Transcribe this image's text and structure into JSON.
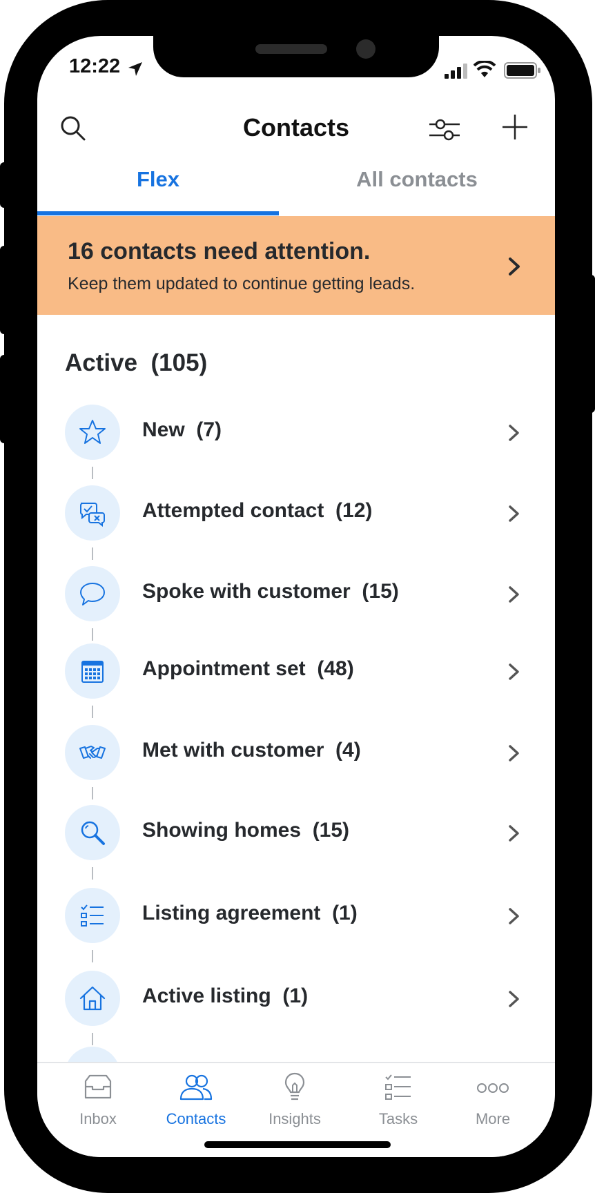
{
  "status_bar": {
    "time": "12:22"
  },
  "nav": {
    "title": "Contacts"
  },
  "tabs": [
    {
      "label": "Flex",
      "active": true
    },
    {
      "label": "All contacts",
      "active": false
    }
  ],
  "banner": {
    "title": "16 contacts need attention.",
    "subtitle": "Keep them updated to continue getting leads."
  },
  "section": {
    "label": "Active",
    "count": "(105)"
  },
  "stages": [
    {
      "label": "New",
      "count": "(7)",
      "icon": "star-icon"
    },
    {
      "label": "Attempted contact",
      "count": "(12)",
      "icon": "chat-bubbles-icon"
    },
    {
      "label": "Spoke with customer",
      "count": "(15)",
      "icon": "speech-bubble-icon"
    },
    {
      "label": "Appointment set",
      "count": "(48)",
      "icon": "calendar-icon"
    },
    {
      "label": "Met with customer",
      "count": "(4)",
      "icon": "handshake-icon"
    },
    {
      "label": "Showing homes",
      "count": "(15)",
      "icon": "magnifier-icon"
    },
    {
      "label": "Listing agreement",
      "count": "(1)",
      "icon": "checklist-icon"
    },
    {
      "label": "Active listing",
      "count": "(1)",
      "icon": "house-icon"
    }
  ],
  "tabbar": [
    {
      "label": "Inbox",
      "icon": "inbox-icon",
      "active": false
    },
    {
      "label": "Contacts",
      "icon": "contacts-icon",
      "active": true
    },
    {
      "label": "Insights",
      "icon": "lightbulb-icon",
      "active": false
    },
    {
      "label": "Tasks",
      "icon": "tasks-icon",
      "active": false
    },
    {
      "label": "More",
      "icon": "more-icon",
      "active": false
    }
  ],
  "colors": {
    "accent": "#1773e0",
    "banner": "#f9bb86",
    "icon_bg": "#e4f0fc",
    "text": "#26292d",
    "muted": "#8b8f94"
  }
}
